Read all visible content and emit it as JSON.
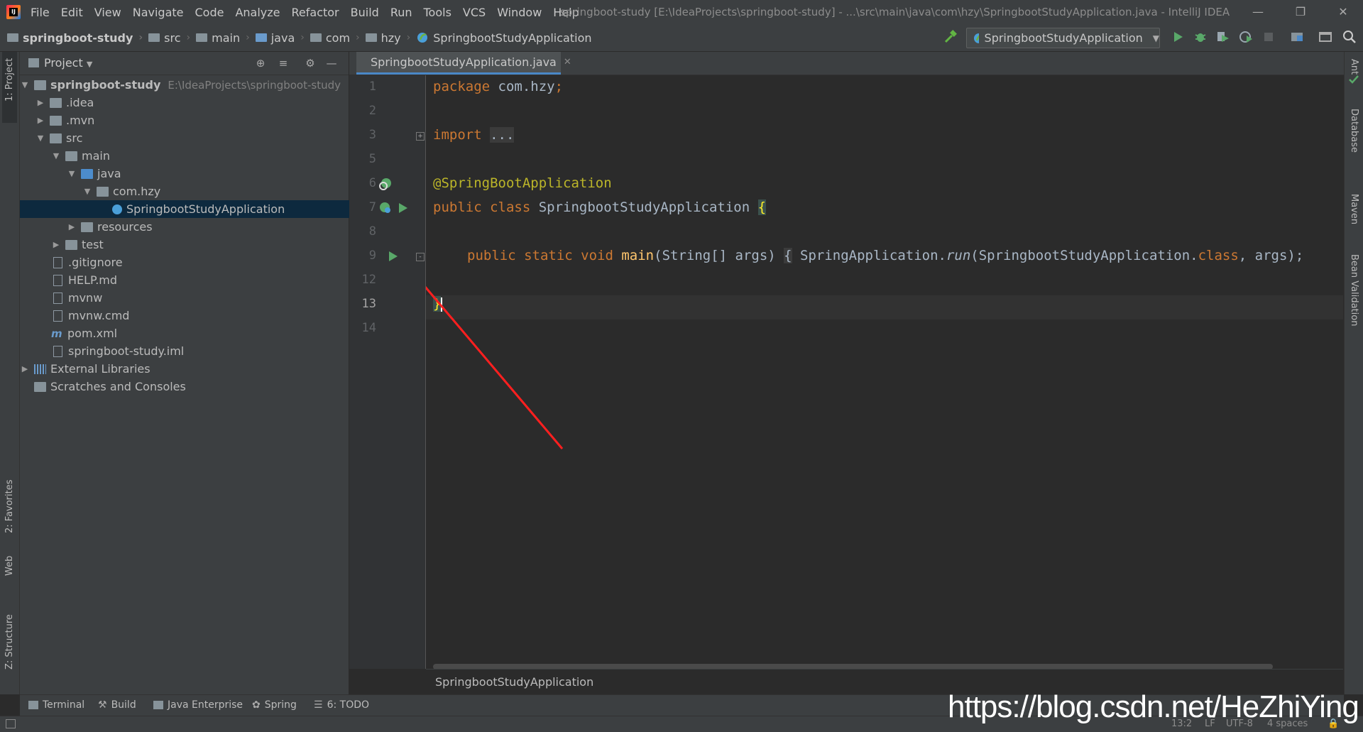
{
  "menubar": {
    "items": [
      "File",
      "Edit",
      "View",
      "Navigate",
      "Code",
      "Analyze",
      "Refactor",
      "Build",
      "Run",
      "Tools",
      "VCS",
      "Window",
      "Help"
    ],
    "window_title": "springboot-study [E:\\IdeaProjects\\springboot-study] - ...\\src\\main\\java\\com\\hzy\\SpringbootStudyApplication.java - IntelliJ IDEA",
    "logo_text": "IJ"
  },
  "navbar": {
    "crumbs": [
      "springboot-study",
      "src",
      "main",
      "java",
      "com",
      "hzy",
      "SpringbootStudyApplication"
    ],
    "run_config": "SpringbootStudyApplication"
  },
  "left_strip": {
    "project_tab": "1: Project",
    "favorites_tab": "2: Favorites",
    "web_tab": "Web",
    "structure_tab": "Z: Structure"
  },
  "right_strip": {
    "ant_tab": "Ant",
    "database_tab": "Database",
    "maven_tab": "Maven",
    "bean_validation_tab": "Bean Validation"
  },
  "project_panel": {
    "title": "Project",
    "tree": [
      {
        "label": "springboot-study",
        "path": "E:\\IdeaProjects\\springboot-study"
      },
      {
        "label": ".idea"
      },
      {
        "label": ".mvn"
      },
      {
        "label": "src"
      },
      {
        "label": "main"
      },
      {
        "label": "java"
      },
      {
        "label": "com.hzy"
      },
      {
        "label": "SpringbootStudyApplication"
      },
      {
        "label": "resources"
      },
      {
        "label": "test"
      },
      {
        "label": ".gitignore"
      },
      {
        "label": "HELP.md"
      },
      {
        "label": "mvnw"
      },
      {
        "label": "mvnw.cmd"
      },
      {
        "label": "pom.xml"
      },
      {
        "label": "springboot-study.iml"
      },
      {
        "label": "External Libraries"
      },
      {
        "label": "Scratches and Consoles"
      }
    ]
  },
  "editor": {
    "tab_label": "SpringbootStudyApplication.java",
    "line_numbers": [
      "1",
      "2",
      "3",
      "5",
      "6",
      "7",
      "8",
      "9",
      "12",
      "13",
      "14"
    ],
    "code": {
      "l1_kw": "package",
      "l1_rest": " com.hzy",
      "l1_semi": ";",
      "l3_kw": "import",
      "l3_fold": "...",
      "l6_ann": "@SpringBootApplication",
      "l7_kw": "public class",
      "l7_name": " SpringbootStudyApplication ",
      "l7_brace": "{",
      "l9_kw": "public static void",
      "l9_method": "main",
      "l9_args": "(String[] args) ",
      "l9_fold": "{",
      "l9_call1": " SpringApplication.",
      "l9_run": "run",
      "l9_call2": "(SpringbootStudyApplication.",
      "l9_class": "class",
      "l9_call3": ", args);",
      "l13_brace": "}"
    },
    "breadcrumb": "SpringbootStudyApplication"
  },
  "bottom_tabs": [
    "Terminal",
    "Build",
    "Java Enterprise",
    "Spring",
    "6: TODO"
  ],
  "status": {
    "position": "13:2",
    "line_sep": "LF",
    "encoding": "UTF-8",
    "indent": "4 spaces"
  },
  "watermark": "https://blog.csdn.net/HeZhiYing"
}
